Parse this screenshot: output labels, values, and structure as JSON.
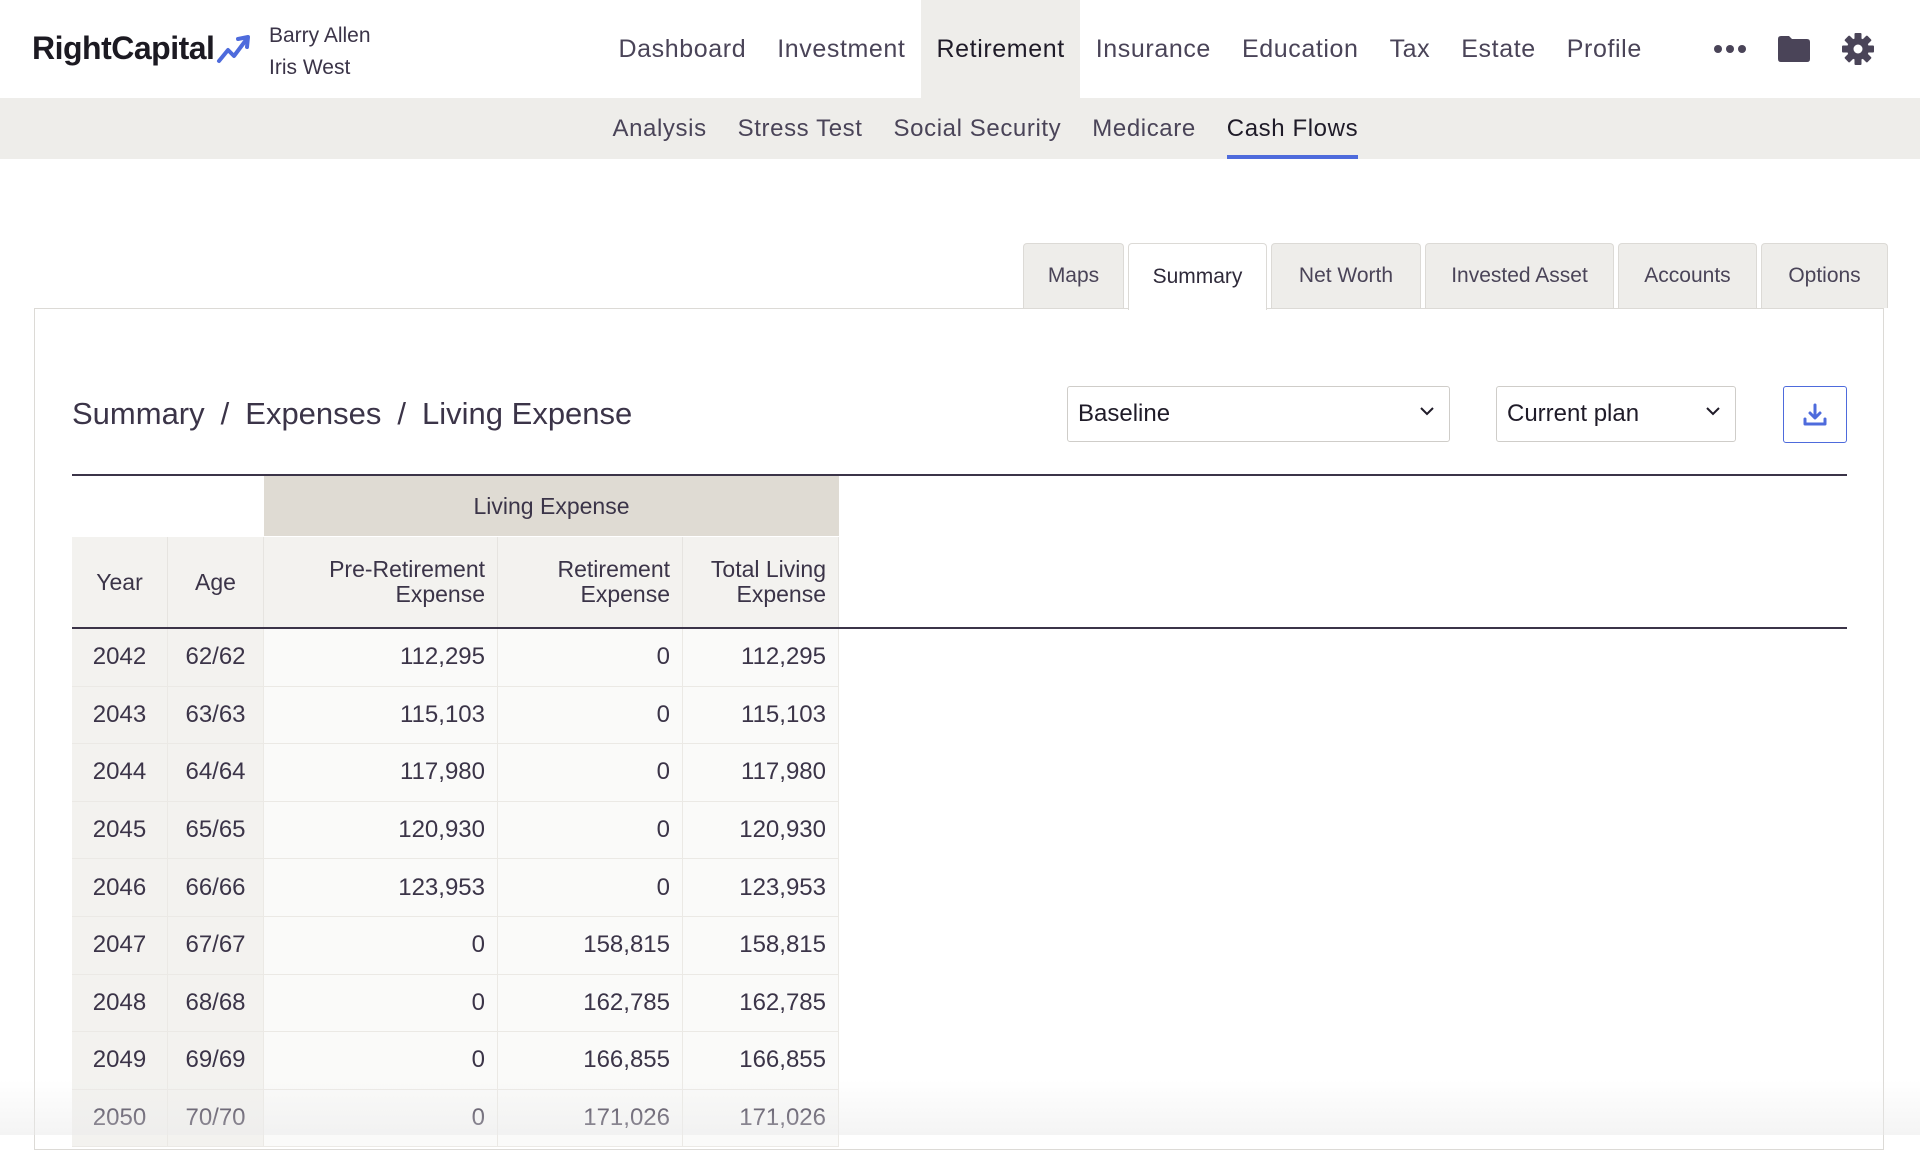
{
  "header": {
    "brand": "RightCapital",
    "clients": [
      "Barry Allen",
      "Iris West"
    ],
    "nav": [
      "Dashboard",
      "Investment",
      "Retirement",
      "Insurance",
      "Education",
      "Tax",
      "Estate",
      "Profile"
    ],
    "nav_active": "Retirement",
    "icons": [
      "more-icon",
      "folder-icon",
      "gear-icon"
    ]
  },
  "subnav": {
    "items": [
      "Analysis",
      "Stress Test",
      "Social Security",
      "Medicare",
      "Cash Flows"
    ],
    "active": "Cash Flows"
  },
  "tabs": {
    "items": [
      "Maps",
      "Summary",
      "Net Worth",
      "Invested Asset",
      "Accounts",
      "Options"
    ],
    "active": "Summary"
  },
  "breadcrumb": [
    "Summary",
    "Expenses",
    "Living Expense"
  ],
  "controls": {
    "scenario_select": "Baseline",
    "plan_select": "Current plan",
    "download_icon": "download-icon"
  },
  "table": {
    "group_header": "Living Expense",
    "columns": {
      "year": "Year",
      "age": "Age",
      "pre": [
        "Pre-Retirement",
        "Expense"
      ],
      "ret": [
        "Retirement",
        "Expense"
      ],
      "total": [
        "Total Living",
        "Expense"
      ]
    },
    "rows": [
      {
        "year": "2042",
        "age": "62/62",
        "pre": "112,295",
        "ret": "0",
        "total": "112,295"
      },
      {
        "year": "2043",
        "age": "63/63",
        "pre": "115,103",
        "ret": "0",
        "total": "115,103"
      },
      {
        "year": "2044",
        "age": "64/64",
        "pre": "117,980",
        "ret": "0",
        "total": "117,980"
      },
      {
        "year": "2045",
        "age": "65/65",
        "pre": "120,930",
        "ret": "0",
        "total": "120,930"
      },
      {
        "year": "2046",
        "age": "66/66",
        "pre": "123,953",
        "ret": "0",
        "total": "123,953"
      },
      {
        "year": "2047",
        "age": "67/67",
        "pre": "0",
        "ret": "158,815",
        "total": "158,815"
      },
      {
        "year": "2048",
        "age": "68/68",
        "pre": "0",
        "ret": "162,785",
        "total": "162,785"
      },
      {
        "year": "2049",
        "age": "69/69",
        "pre": "0",
        "ret": "166,855",
        "total": "166,855"
      },
      {
        "year": "2050",
        "age": "70/70",
        "pre": "0",
        "ret": "171,026",
        "total": "171,026"
      }
    ]
  },
  "colors": {
    "accent": "#4e6bdc",
    "nav_bg": "#eeedea",
    "group_header_bg": "#dfdbd3",
    "text": "#3b3448"
  }
}
